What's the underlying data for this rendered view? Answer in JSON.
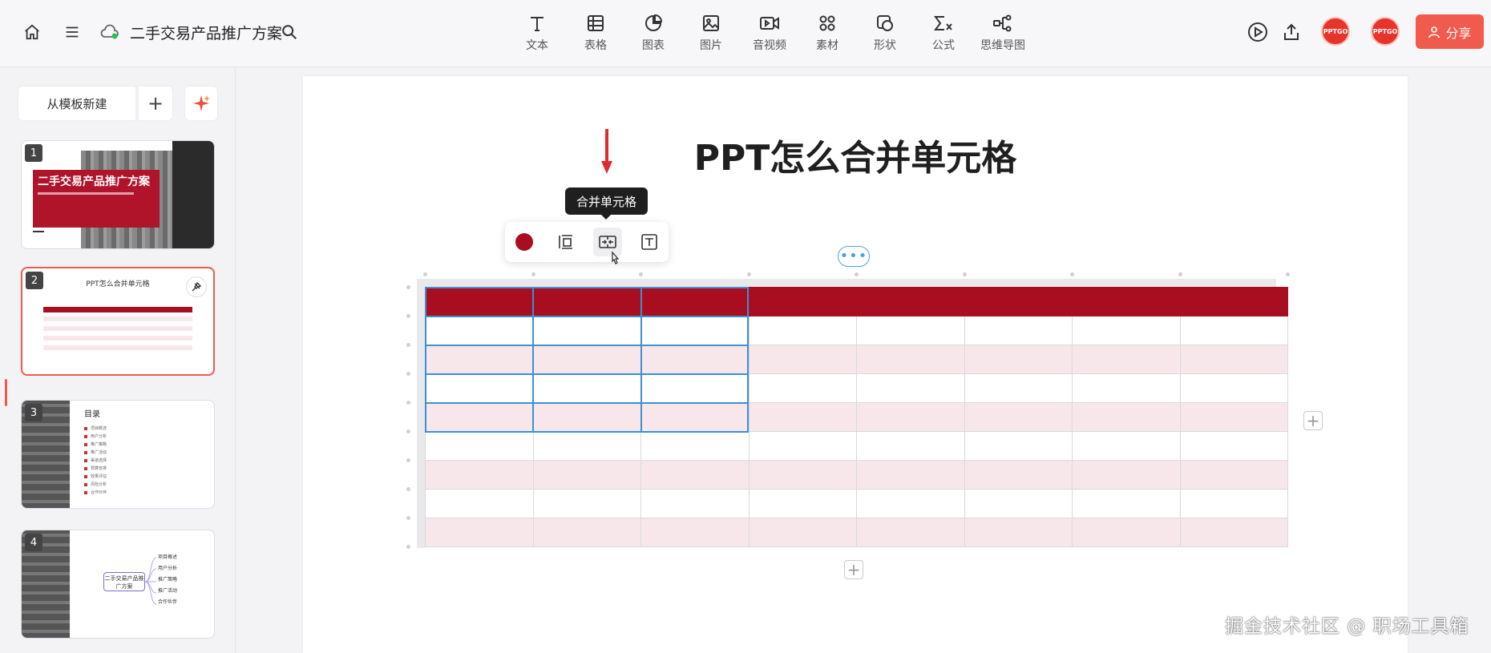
{
  "topbar": {
    "doc_title": "二手交易产品推广方案",
    "tools": [
      {
        "label": "文本",
        "icon": "text-icon"
      },
      {
        "label": "表格",
        "icon": "table-icon"
      },
      {
        "label": "图表",
        "icon": "chart-icon"
      },
      {
        "label": "图片",
        "icon": "image-icon"
      },
      {
        "label": "音视频",
        "icon": "video-icon"
      },
      {
        "label": "素材",
        "icon": "material-icon"
      },
      {
        "label": "形状",
        "icon": "shape-icon"
      },
      {
        "label": "公式",
        "icon": "formula-icon"
      },
      {
        "label": "思维导图",
        "icon": "mindmap-icon"
      }
    ],
    "share_label": "分享",
    "avatar_text": "PPTGO",
    "accent_color": "#f15b4d"
  },
  "sidebar": {
    "new_from_template": "从模板新建",
    "slides": [
      {
        "num": "1",
        "title": "二手交易产品推广方案"
      },
      {
        "num": "2",
        "title": "PPT怎么合并单元格"
      },
      {
        "num": "3",
        "title": "目录",
        "items": [
          "项目概述",
          "用户分析",
          "推广策略",
          "推广活动",
          "渠道选择",
          "预算安排",
          "效果评估",
          "风险分析",
          "合作伙伴"
        ]
      },
      {
        "num": "4",
        "center": "二手交易产品推广方案",
        "branches": [
          "项目概述",
          "用户分析",
          "推广策略",
          "推广活动",
          "合作伙伴"
        ]
      }
    ],
    "active_slide": 2
  },
  "slide": {
    "title": "PPT怎么合并单元格",
    "tooltip": "合并单元格",
    "more_label": "•••",
    "table": {
      "rows": 9,
      "cols": 8,
      "header_color": "#a90e20",
      "stripe_color": "#f7e7ea",
      "selection_color": "#3d8fd8"
    }
  },
  "watermark": "掘金技术社区 @ 职场工具箱"
}
